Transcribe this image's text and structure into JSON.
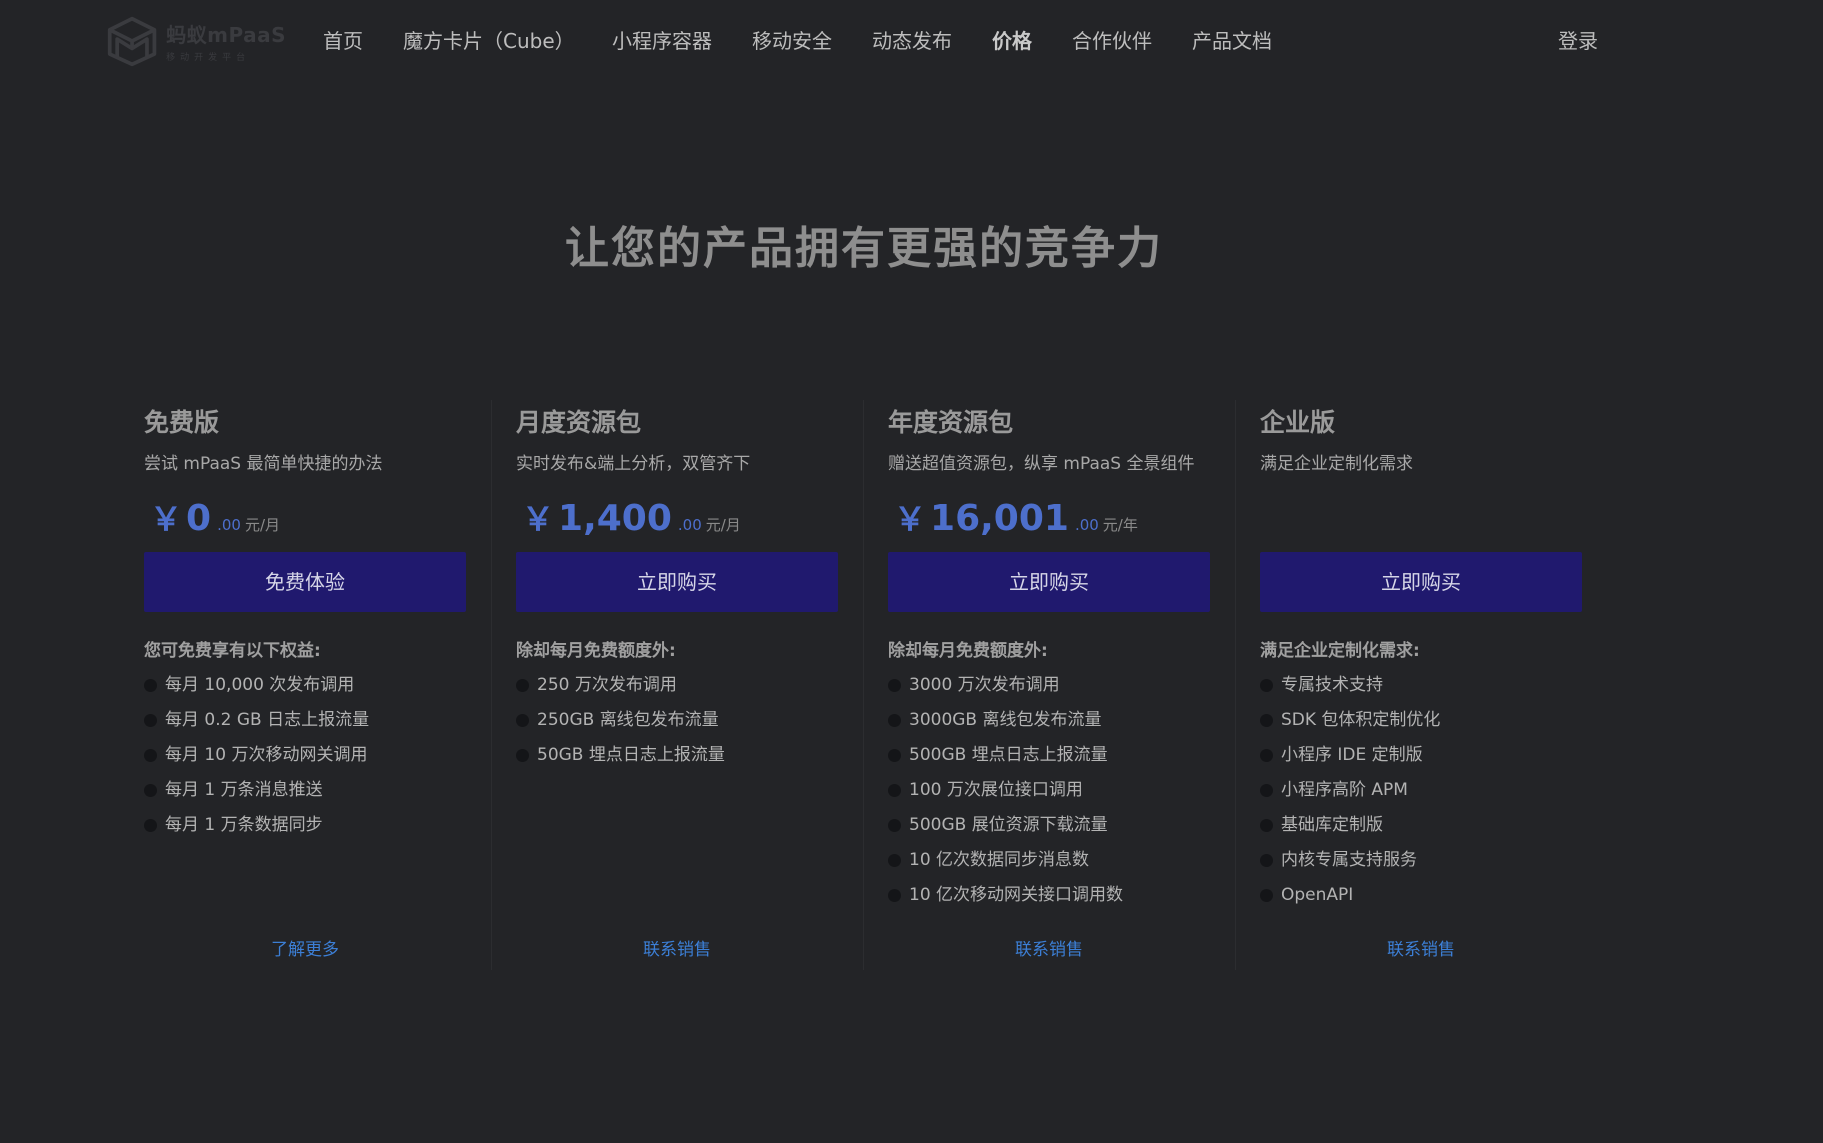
{
  "header": {
    "logo_name": "蚂蚁mPaaS",
    "logo_sub": "移动开发平台",
    "nav": [
      {
        "label": "首页"
      },
      {
        "label": "魔方卡片（Cube）"
      },
      {
        "label": "小程序容器"
      },
      {
        "label": "移动安全"
      },
      {
        "label": "动态发布"
      },
      {
        "label": "价格"
      },
      {
        "label": "合作伙伴"
      },
      {
        "label": "产品文档"
      }
    ],
    "active_nav": "价格",
    "login": "登录"
  },
  "headline": "让您的产品拥有更强的竞争力",
  "plans": [
    {
      "name": "免费版",
      "desc": "尝试 mPaaS 最简单快捷的办法",
      "currency": "￥",
      "price": "0",
      "decimals": ".00",
      "unit": "元/月",
      "cta": "免费体验",
      "features_title": "您可免费享有以下权益:",
      "features": [
        "每月 10,000 次发布调用",
        "每月 0.2 GB 日志上报流量",
        "每月 10 万次移动网关调用",
        "每月 1 万条消息推送",
        "每月 1 万条数据同步"
      ],
      "link": "了解更多"
    },
    {
      "name": "月度资源包",
      "desc": "实时发布&端上分析，双管齐下",
      "currency": "￥",
      "price": "1,400",
      "decimals": ".00",
      "unit": "元/月",
      "cta": "立即购买",
      "features_title": "除却每月免费额度外:",
      "features": [
        "250 万次发布调用",
        "250GB 离线包发布流量",
        "50GB 埋点日志上报流量"
      ],
      "link": "联系销售"
    },
    {
      "name": "年度资源包",
      "desc": "赠送超值资源包，纵享 mPaaS 全景组件",
      "currency": "￥",
      "price": "16,001",
      "decimals": ".00",
      "unit": "元/年",
      "cta": "立即购买",
      "features_title": "除却每月免费额度外:",
      "features": [
        "3000 万次发布调用",
        "3000GB 离线包发布流量",
        "500GB 埋点日志上报流量",
        "100 万次展位接口调用",
        "500GB 展位资源下载流量",
        "10 亿次数据同步消息数",
        "10 亿次移动网关接口调用数"
      ],
      "link": "联系销售"
    },
    {
      "name": "企业版",
      "desc": "满足企业定制化需求",
      "cta": "立即购买",
      "features_title": "满足企业定制化需求:",
      "features": [
        "专属技术支持",
        "SDK 包体积定制优化",
        "小程序 IDE 定制版",
        "小程序高阶 APM",
        "基础库定制版",
        "内核专属支持服务",
        "OpenAPI"
      ],
      "link": "联系销售"
    }
  ],
  "colors": {
    "background": "#232427",
    "price": "#4d6fcc",
    "cta_bg": "#20196e",
    "link": "#3c7fd6"
  }
}
